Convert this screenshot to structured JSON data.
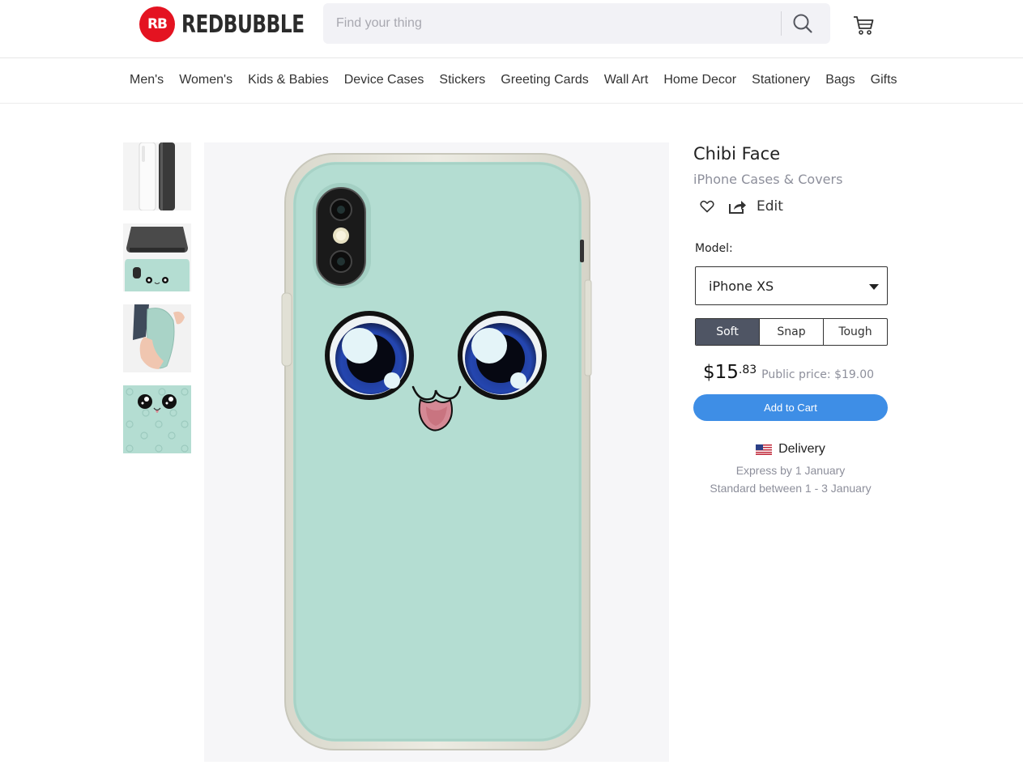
{
  "header": {
    "logo_badge": "RB",
    "logo_text": "REDBUBBLE",
    "search_placeholder": "Find your thing",
    "icons": {
      "search": "search-icon",
      "cart": "cart-icon"
    }
  },
  "nav": {
    "items": [
      "Men's",
      "Women's",
      "Kids & Babies",
      "Device Cases",
      "Stickers",
      "Greeting Cards",
      "Wall Art",
      "Home Decor",
      "Stationery",
      "Bags",
      "Gifts"
    ]
  },
  "product": {
    "title": "Chibi Face",
    "category": "iPhone Cases & Covers",
    "edit_label": "Edit",
    "model_label": "Model:",
    "model_selected": "iPhone XS",
    "case_types": [
      {
        "label": "Soft",
        "active": true
      },
      {
        "label": "Snap",
        "active": false
      },
      {
        "label": "Tough",
        "active": false
      }
    ],
    "price_main": "$15",
    "price_cents": ".83",
    "public_price": "Public price: $19.00",
    "add_to_cart": "Add to Cart",
    "delivery": {
      "title": "Delivery",
      "express": "Express by 1 January",
      "standard": "Standard between 1 - 3 January"
    }
  },
  "colors": {
    "brand_red": "#e41321",
    "case_mint": "#b4ddd2",
    "button_blue": "#3e8ee6",
    "segment_active": "#4f5564",
    "muted_text": "#8d8f9b"
  }
}
